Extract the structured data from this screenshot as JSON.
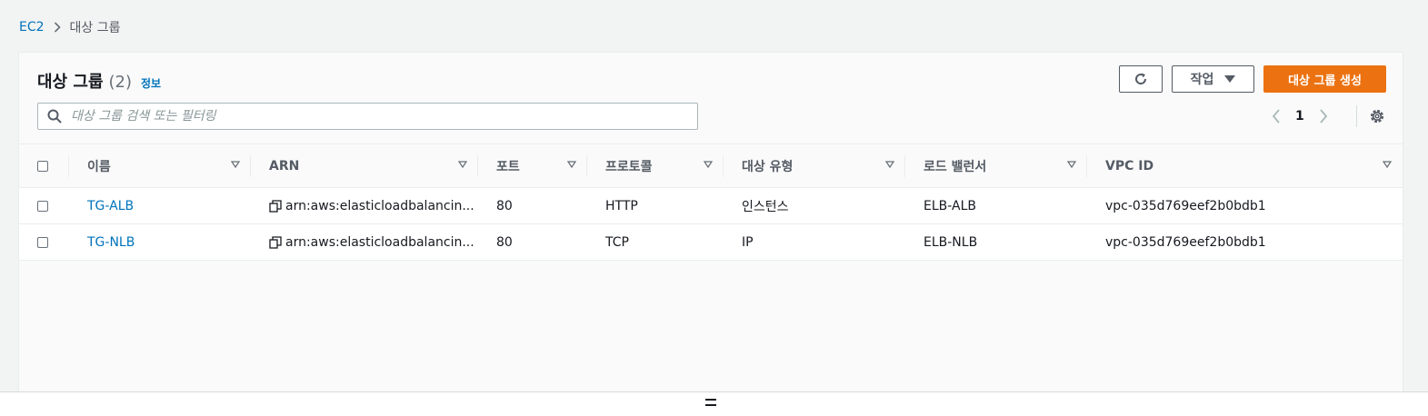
{
  "breadcrumb": {
    "root": "EC2",
    "current": "대상 그룹"
  },
  "header": {
    "title": "대상 그룹",
    "count": "(2)",
    "info_link": "정보",
    "action_button": "작업",
    "create_button": "대상 그룹 생성"
  },
  "search": {
    "placeholder": "대상 그룹 검색 또는 필터링",
    "value": ""
  },
  "pagination": {
    "current_page": "1"
  },
  "table": {
    "columns": [
      "이름",
      "ARN",
      "포트",
      "프로토콜",
      "대상 유형",
      "로드 밸런서",
      "VPC ID"
    ],
    "rows": [
      {
        "name": "TG-ALB",
        "arn": "arn:aws:elasticloadbalancin...",
        "port": "80",
        "protocol": "HTTP",
        "target_type": "인스턴스",
        "load_balancer": "ELB-ALB",
        "vpc_id": "vpc-035d769eef2b0bdb1"
      },
      {
        "name": "TG-NLB",
        "arn": "arn:aws:elasticloadbalancin...",
        "port": "80",
        "protocol": "TCP",
        "target_type": "IP",
        "load_balancer": "ELB-NLB",
        "vpc_id": "vpc-035d769eef2b0bdb1"
      }
    ]
  },
  "colors": {
    "link": "#0073bb",
    "primary_button": "#ec7211",
    "background": "#f2f3f3"
  }
}
